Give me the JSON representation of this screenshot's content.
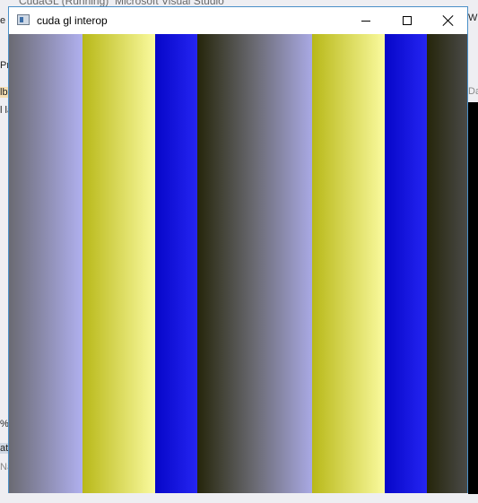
{
  "background_app": {
    "title_left": "CudaGL (Running)",
    "title_right": "Microsoft Visual Studio",
    "left_fragments": [
      "e",
      "Pr",
      "lb",
      "l la",
      "%",
      "ate",
      "Na"
    ],
    "right_fragments": [
      "W",
      "Da"
    ]
  },
  "window": {
    "title": "cuda gl interop",
    "icon": "app-window-icon",
    "controls": [
      "minimize-icon",
      "maximize-icon",
      "close-icon"
    ],
    "border_color": "#4a90c8"
  },
  "canvas": {
    "stripes": [
      {
        "from": "#6a6a72",
        "to": "#b0b0ef"
      },
      {
        "from": "#b8b818",
        "to": "#fafa9e"
      },
      {
        "from": "#0606c8",
        "to": "#2525f2"
      },
      {
        "from": "#25250a",
        "to": "#6a6a72",
        "mid": "#a9a9e4"
      },
      {
        "from": "#b8b818",
        "to": "#fafa9e"
      },
      {
        "from": "#0606c8",
        "to": "#2525f2"
      },
      {
        "from": "#25250a",
        "to": "#4a4a48"
      }
    ]
  }
}
